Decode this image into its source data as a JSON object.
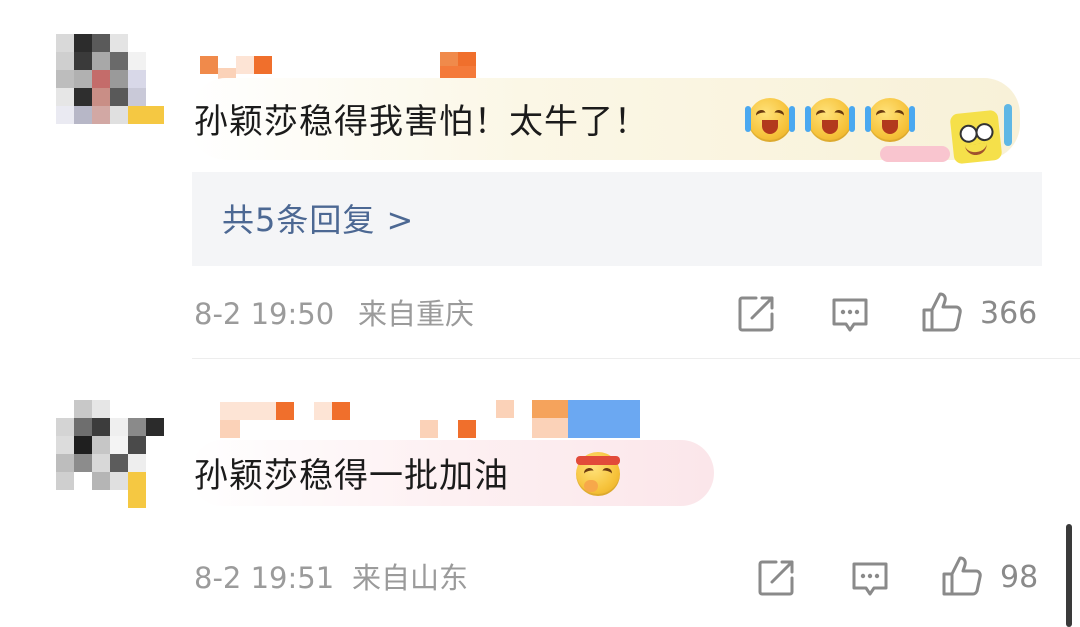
{
  "comments": [
    {
      "text": "孙颖莎稳得我害怕！太牛了！",
      "replies_label": "共5条回复 >",
      "timestamp": "8-2 19:50",
      "location": "来自重庆",
      "likes": "366",
      "emoji": [
        "laugh-cry-icon",
        "laugh-cry-icon",
        "laugh-cry-icon"
      ],
      "bubble_color": "#fbf6e4"
    },
    {
      "text": "孙颖莎稳得一批加油",
      "timestamp": "8-2 19:51",
      "location": "来自山东",
      "likes": "98",
      "emoji": [
        "cheer-icon"
      ],
      "bubble_color": "#fcecef"
    }
  ],
  "colors": {
    "link": "#4c6893",
    "meta": "#9b9b9b",
    "text": "#1b1b1b",
    "replies_bg": "#f4f5f7"
  }
}
